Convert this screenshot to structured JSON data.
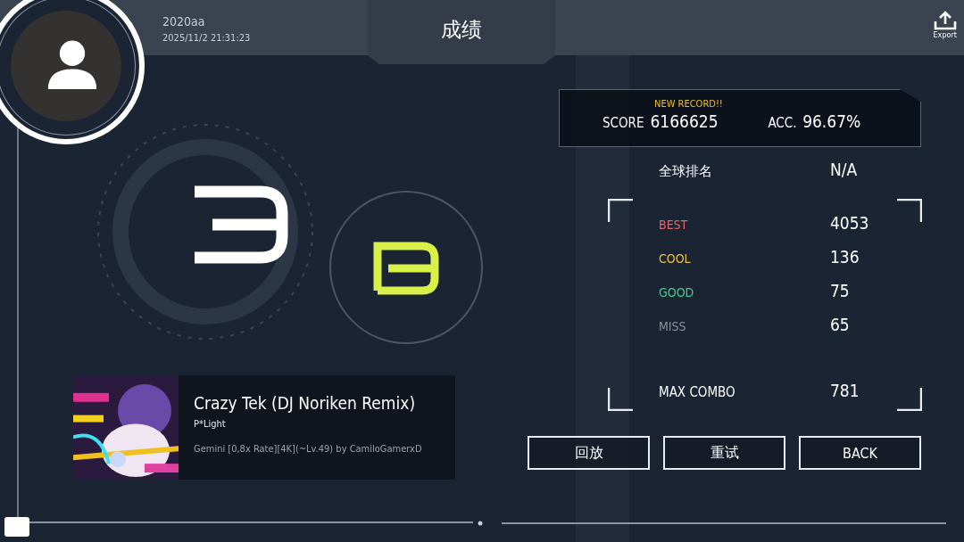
{
  "player": {
    "name": "2020aa",
    "time": "2025/11/2 21:31:23"
  },
  "title": "成绩",
  "export": {
    "label": "Export"
  },
  "score": {
    "badge": "NEW RECORD!!",
    "score_label": "SCORE",
    "score": "6166625",
    "acc_label": "ACC.",
    "acc": "96.67%"
  },
  "rank": {
    "label": "全球排名",
    "value": "N/A"
  },
  "judgements": [
    {
      "label": "BEST",
      "value": "4053",
      "color": "#e0646e"
    },
    {
      "label": "COOL",
      "value": "136",
      "color": "#e8c044"
    },
    {
      "label": "GOOD",
      "value": "75",
      "color": "#3ecf8e"
    },
    {
      "label": "MISS",
      "value": "65",
      "color": "#8a9099"
    }
  ],
  "max_combo": {
    "label": "MAX COMBO",
    "value": "781"
  },
  "song": {
    "title": "Crazy Tek (DJ Noriken Remix)",
    "artist": "P*Light",
    "chart": "Gemini [0,8x Rate][4K](~Lv.49) by CamiloGamerxD"
  },
  "buttons": [
    {
      "label": "回放"
    },
    {
      "label": "重试"
    },
    {
      "label": "BACK"
    }
  ]
}
